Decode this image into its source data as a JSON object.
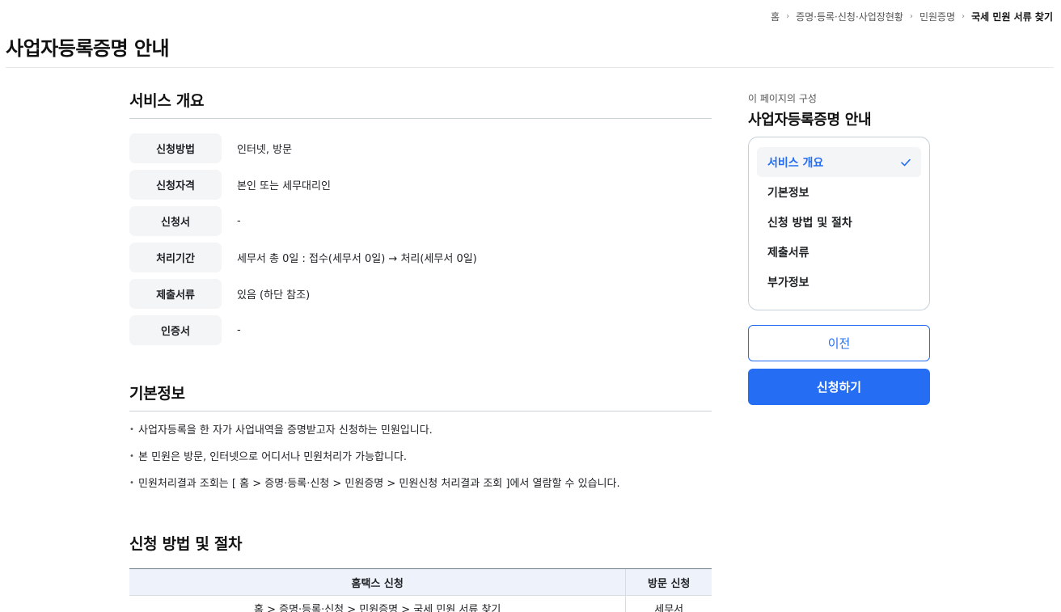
{
  "breadcrumb": {
    "items": [
      "홈",
      "증명·등록·신청·사업장현황",
      "민원증명",
      "국세 민원 서류 찾기"
    ]
  },
  "page": {
    "title": "사업자등록증명 안내"
  },
  "overview": {
    "title": "서비스 개요",
    "rows": [
      {
        "label": "신청방법",
        "value": "인터넷, 방문"
      },
      {
        "label": "신청자격",
        "value": "본인 또는 세무대리인"
      },
      {
        "label": "신청서",
        "value": "-"
      },
      {
        "label": "처리기간",
        "value": "세무서 총 0일 : 접수(세무서 0일) → 처리(세무서 0일)"
      },
      {
        "label": "제출서류",
        "value": "있음 (하단 참조)"
      },
      {
        "label": "인증서",
        "value": "-"
      }
    ]
  },
  "basic": {
    "title": "기본정보",
    "bullets": [
      "사업자등록을 한 자가 사업내역을 증명받고자 신청하는 민원입니다.",
      "본 민원은 방문, 인터넷으로 어디서나 민원처리가 가능합니다.",
      "민원처리결과 조회는 [ 홈 > 증명·등록·신청 > 민원증명 > 민원신청 처리결과 조회 ]에서 열람할 수 있습니다."
    ]
  },
  "method": {
    "title": "신청 방법 및 절차",
    "headers": [
      "홈택스 신청",
      "방문 신청"
    ],
    "rows": [
      [
        "홈 > 증명·등록·신청 > 민원증명 > 국세 민원 서류 찾기",
        "세무서"
      ]
    ]
  },
  "aside": {
    "subtitle": "이 페이지의 구성",
    "title": "사업자등록증명 안내",
    "toc": [
      "서비스 개요",
      "기본정보",
      "신청 방법 및 절차",
      "제출서류",
      "부가정보"
    ],
    "active_index": 0,
    "prev_label": "이전",
    "apply_label": "신청하기"
  },
  "colors": {
    "accent": "#256ef4",
    "label_bg": "#f4f5f6",
    "table_header_bg": "#eef3fb"
  },
  "icons": {
    "breadcrumb_separator": "chevron-right-icon",
    "toc_active": "check-icon"
  }
}
